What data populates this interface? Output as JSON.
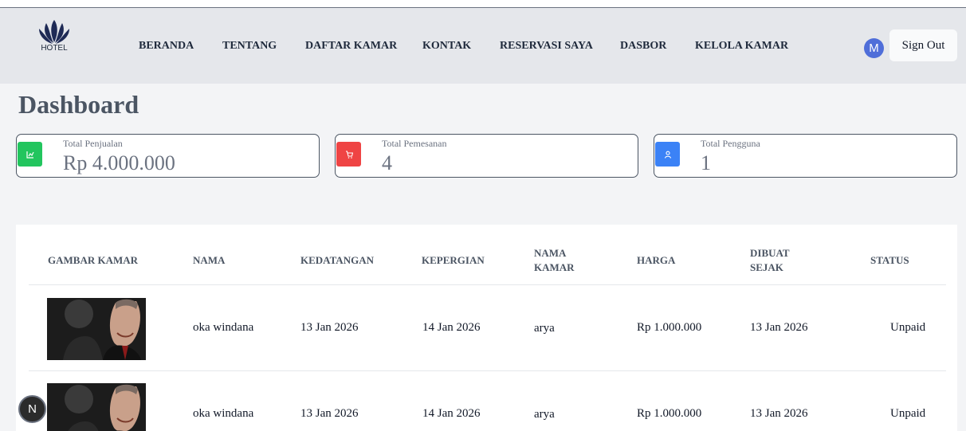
{
  "brand": {
    "logo_text": "HOTEL"
  },
  "nav": {
    "items": [
      {
        "label": "BERANDA"
      },
      {
        "label": "TENTANG"
      },
      {
        "label": "DAFTAR KAMAR"
      },
      {
        "label": "KONTAK"
      },
      {
        "label": "RESERVASI SAYA"
      },
      {
        "label": "DASBOR"
      },
      {
        "label": "KELOLA KAMAR"
      }
    ],
    "avatar_initial": "M",
    "signout_label": "Sign Out"
  },
  "page": {
    "title": "Dashboard"
  },
  "stats": [
    {
      "label": "Total Penjualan",
      "value": "Rp 4.000.000",
      "color": "#22c55e",
      "icon": "chart-icon"
    },
    {
      "label": "Total Pemesanan",
      "value": "4",
      "color": "#ef4444",
      "icon": "cart-icon"
    },
    {
      "label": "Total Pengguna",
      "value": "1",
      "color": "#3b82f6",
      "icon": "user-icon"
    }
  ],
  "table": {
    "headers": {
      "gambar": "GAMBAR KAMAR",
      "nama": "NAMA",
      "kedatangan": "KEDATANGAN",
      "kepergian": "KEPERGIAN",
      "nama_kamar_1": "NAMA",
      "nama_kamar_2": "KAMAR",
      "harga": "HARGA",
      "dibuat_1": "DIBUAT",
      "dibuat_2": "SEJAK",
      "status": "STATUS"
    },
    "rows": [
      {
        "nama": "oka windana",
        "kedatangan": "13 Jan 2026",
        "kepergian": "14 Jan 2026",
        "kamar": "arya",
        "harga": "Rp 1.000.000",
        "dibuat": "13 Jan 2026",
        "status": "Unpaid"
      },
      {
        "nama": "oka windana",
        "kedatangan": "13 Jan 2026",
        "kepergian": "14 Jan 2026",
        "kamar": "arya",
        "harga": "Rp 1.000.000",
        "dibuat": "13 Jan 2026",
        "status": "Unpaid"
      }
    ]
  },
  "fab": {
    "label": "N"
  }
}
